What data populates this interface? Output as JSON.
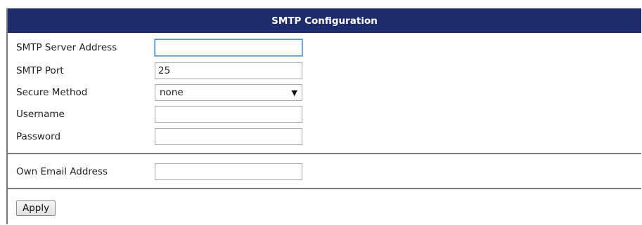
{
  "header": {
    "title": "SMTP Configuration"
  },
  "form": {
    "smtp_server_address": {
      "label": "SMTP Server Address",
      "value": ""
    },
    "smtp_port": {
      "label": "SMTP Port",
      "value": "25"
    },
    "secure_method": {
      "label": "Secure Method",
      "value": "none"
    },
    "username": {
      "label": "Username",
      "value": ""
    },
    "password": {
      "label": "Password",
      "value": ""
    },
    "own_email_address": {
      "label": "Own Email Address",
      "value": ""
    }
  },
  "actions": {
    "apply_label": "Apply"
  },
  "icons": {
    "select_caret": "caret-down-icon"
  },
  "colors": {
    "header_bg": "#1f2c6c",
    "focus_border": "#4a90d9"
  }
}
